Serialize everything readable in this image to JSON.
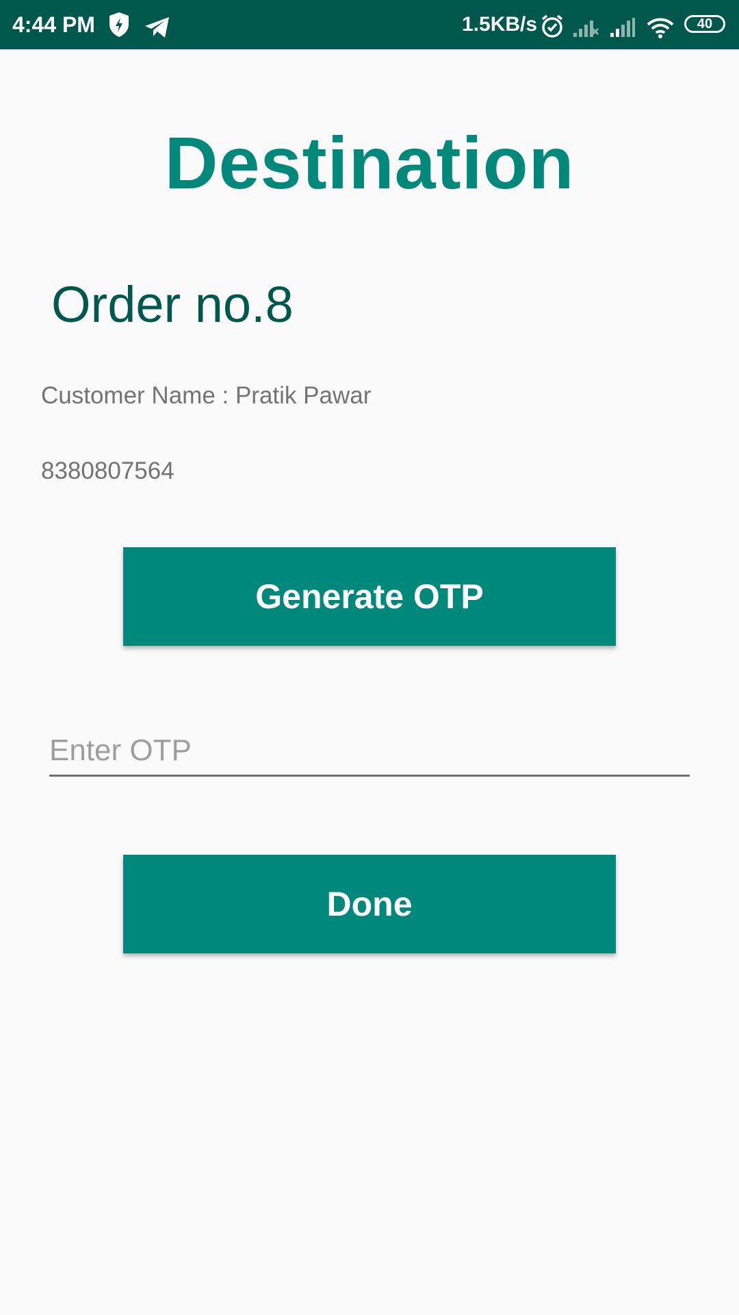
{
  "status_bar": {
    "time": "4:44 PM",
    "network_speed": "1.5KB/s",
    "battery_level": "40",
    "icons": [
      "shield-icon",
      "telegram-icon",
      "alarm-icon",
      "signal-no-service-icon",
      "signal-icon",
      "wifi-icon",
      "battery-icon"
    ]
  },
  "page": {
    "title": "Destination",
    "order_number": "Order no.8",
    "customer_name": "Customer Name : Pratik Pawar",
    "phone": "8380807564"
  },
  "actions": {
    "generate_otp_label": "Generate OTP",
    "otp_placeholder": "Enter OTP",
    "otp_value": "",
    "done_label": "Done"
  },
  "colors": {
    "status_bar": "#00574b",
    "accent": "#00897b",
    "order_text": "#00574b",
    "background": "#fafafa"
  }
}
